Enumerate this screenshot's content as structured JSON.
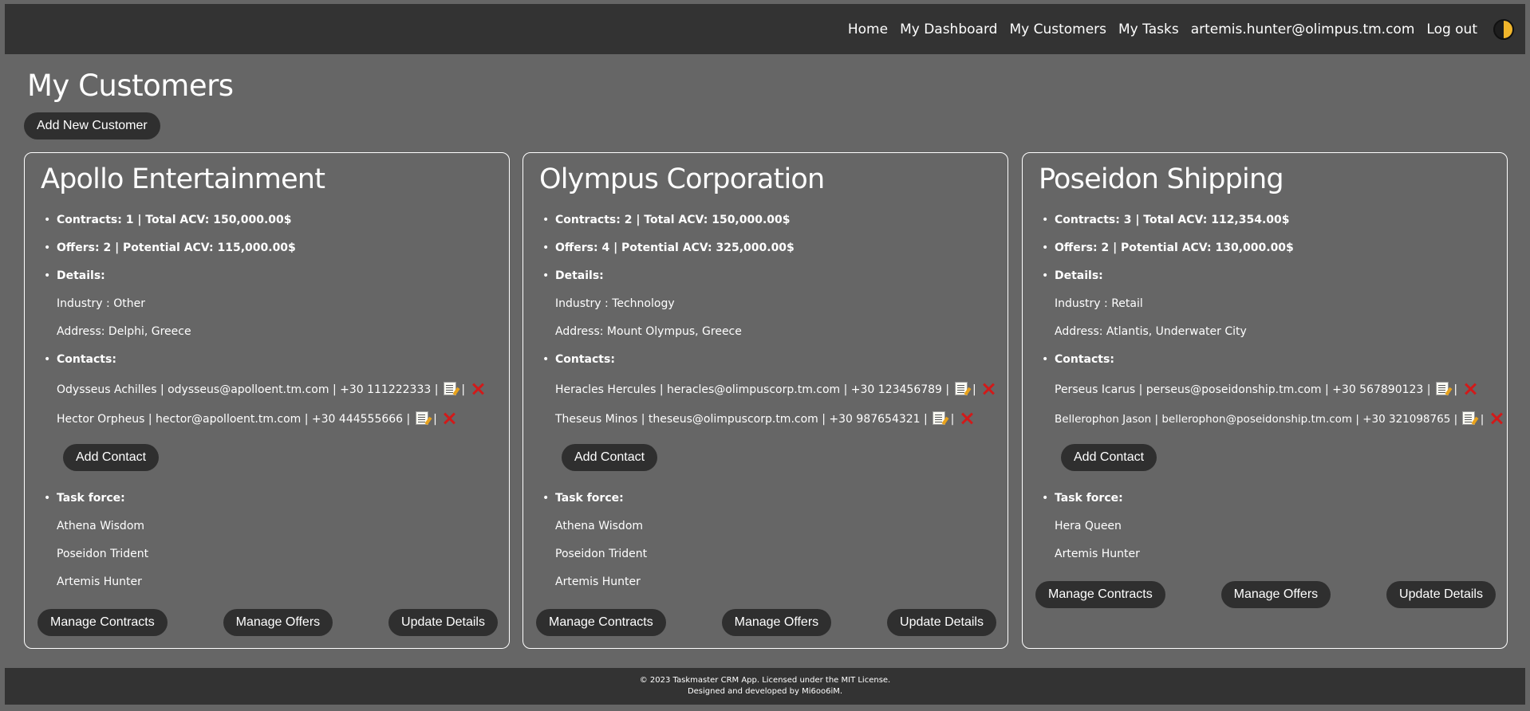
{
  "nav": {
    "home": "Home",
    "dashboard": "My Dashboard",
    "customers": "My Customers",
    "tasks": "My Tasks",
    "user_email": "artemis.hunter@olimpus.tm.com",
    "logout": "Log out",
    "theme_icon": "theme-toggle-icon"
  },
  "page": {
    "title": "My Customers",
    "add_customer_label": "Add New Customer"
  },
  "labels": {
    "details": "Details:",
    "contacts": "Contacts:",
    "task_force": "Task force:",
    "add_contact": "Add Contact",
    "manage_contracts": "Manage Contracts",
    "manage_offers": "Manage Offers",
    "update_details": "Update Details",
    "separator": "|"
  },
  "customers": [
    {
      "name": "Apollo Entertainment",
      "contracts_line": "Contracts: 1 | Total ACV: 150,000.00$",
      "offers_line": "Offers: 2 | Potential ACV: 115,000.00$",
      "industry": "Industry : Other",
      "address": "Address: Delphi, Greece",
      "contacts": [
        "Odysseus Achilles | odysseus@apolloent.tm.com | +30 111222333 |",
        "Hector Orpheus | hector@apolloent.tm.com | +30 444555666 |"
      ],
      "task_force": [
        "Athena Wisdom",
        "Poseidon Trident",
        "Artemis Hunter"
      ]
    },
    {
      "name": "Olympus Corporation",
      "contracts_line": "Contracts: 2 | Total ACV: 150,000.00$",
      "offers_line": "Offers: 4 | Potential ACV: 325,000.00$",
      "industry": "Industry : Technology",
      "address": "Address: Mount Olympus, Greece",
      "contacts": [
        "Heracles Hercules | heracles@olimpuscorp.tm.com | +30 123456789 |",
        "Theseus Minos | theseus@olimpuscorp.tm.com | +30 987654321 |"
      ],
      "task_force": [
        "Athena Wisdom",
        "Poseidon Trident",
        "Artemis Hunter"
      ]
    },
    {
      "name": "Poseidon Shipping",
      "contracts_line": "Contracts: 3 | Total ACV: 112,354.00$",
      "offers_line": "Offers: 2 | Potential ACV: 130,000.00$",
      "industry": "Industry : Retail",
      "address": "Address: Atlantis, Underwater City",
      "contacts": [
        "Perseus Icarus | perseus@poseidonship.tm.com | +30 567890123 |",
        "Bellerophon Jason | bellerophon@poseidonship.tm.com | +30 321098765 |"
      ],
      "task_force": [
        "Hera Queen",
        "Artemis Hunter"
      ]
    }
  ],
  "footer": {
    "line1": "© 2023 Taskmaster CRM App. Licensed under the MIT License.",
    "line2": "Designed and developed by Mi6oo6iM."
  }
}
